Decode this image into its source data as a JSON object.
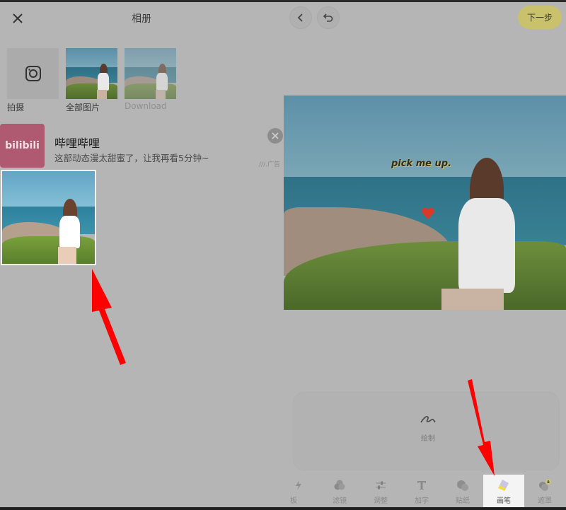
{
  "left_panel": {
    "title": "相册",
    "close_icon": "close-icon",
    "albums": [
      {
        "label": "拍摄",
        "icon": "camera-icon"
      },
      {
        "label": "全部图片"
      },
      {
        "label": "Download"
      }
    ],
    "ad": {
      "app_name": "哔哩哔哩",
      "logo_text": "bilibili",
      "description": "这部动态漫太甜蜜了，让我再看5分钟~",
      "ad_tag": "广告",
      "close_icon": "close-icon"
    },
    "selected_photo": {
      "selected": true
    }
  },
  "right_panel": {
    "back_icon": "chevron-left-icon",
    "undo_icon": "undo-icon",
    "next_label": "下一步",
    "canvas": {
      "caption": "pick me up.",
      "sticker": "heart-sticker"
    },
    "tool_panel": {
      "option_label": "绘制",
      "option_icon": "scribble-icon"
    },
    "tabs": [
      {
        "label": "模板",
        "icon": "template-icon",
        "visible_text": "板"
      },
      {
        "label": "滤镜",
        "icon": "filter-icon"
      },
      {
        "label": "调整",
        "icon": "adjust-icon"
      },
      {
        "label": "加字",
        "icon": "text-icon"
      },
      {
        "label": "贴纸",
        "icon": "sticker-icon"
      },
      {
        "label": "画笔",
        "icon": "brush-icon",
        "active": true
      },
      {
        "label": "遮罩",
        "icon": "mask-icon",
        "locked": true
      }
    ]
  },
  "colors": {
    "overlay_gray": "#b5b5b5",
    "next_button": "#c9c16b",
    "annotation_arrow": "#ff0000",
    "active_tab_bg": "#f4f4f4",
    "bilibili_pink": "#b05a72"
  }
}
